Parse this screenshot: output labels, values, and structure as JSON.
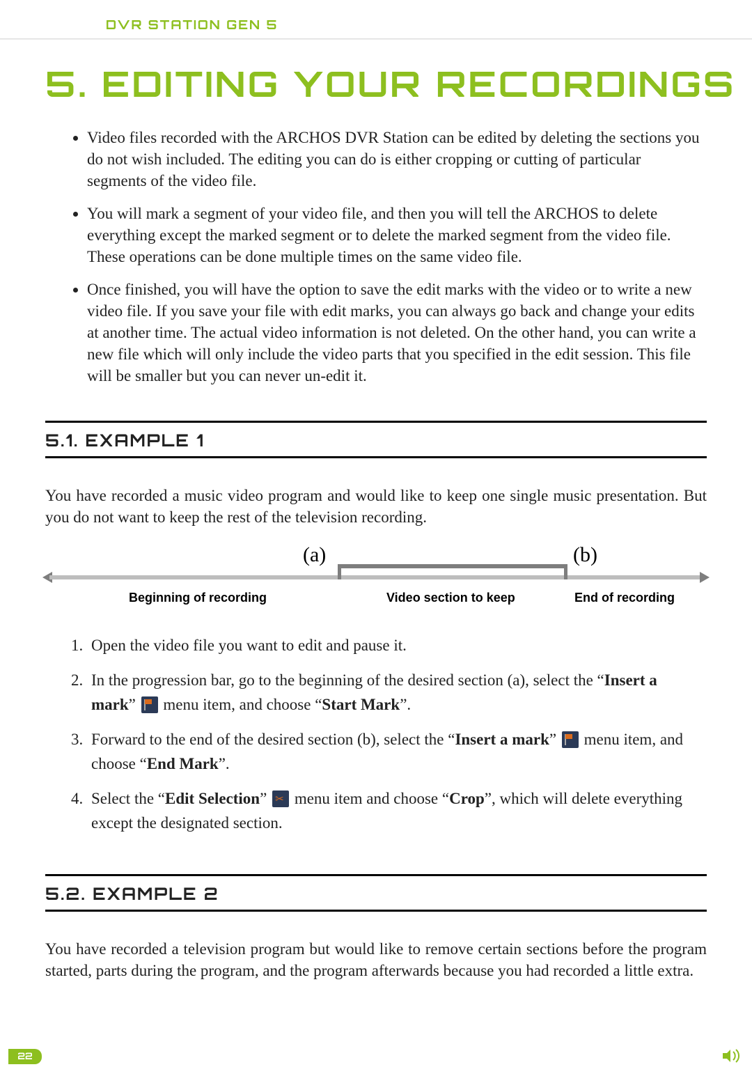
{
  "header": {
    "product": "DVR STATION GEN 5"
  },
  "chapter": {
    "title": "5. EDITING YOUR RECORDINGS"
  },
  "intro_bullets": [
    "Video files recorded with the ARCHOS DVR Station can be edited by deleting the sections you do not wish included. The editing you can do is either cropping or cutting of particular segments of the video file.",
    "You will mark a segment of your video file, and then you will tell the ARCHOS to delete everything except the marked segment or to delete the marked segment from the video file. These operations can be done multiple times on the same video file.",
    "Once finished, you will have the option to save the edit marks with the video or to write a new video file. If you save your file with edit marks, you can always go back and change your edits at another time. The actual video information is not deleted. On the other hand, you can write a new file which will only include the video parts that you specified in the edit session. This file will be smaller but you can never un-edit it."
  ],
  "section1": {
    "heading": "5.1. EXAMPLE 1",
    "para": "You have recorded a music video program and would like to keep one single music presentation. But you do not want to keep the rest of the television recording.",
    "timeline": {
      "a": "(a)",
      "b": "(b)",
      "cap1": "Beginning of recording",
      "cap2": "Video section to keep",
      "cap3": "End of recording"
    },
    "steps": {
      "s1": "Open the video file you want to edit and pause it.",
      "s2a": "In the progression bar, go to the beginning of the desired section (a), select the “",
      "s2b": "Insert a mark",
      "s2c": "” ",
      "s2d": " menu item, and choose “",
      "s2e": "Start Mark",
      "s2f": "”.",
      "s3a": "Forward to the end of the desired section (b), select the “",
      "s3b": "Insert a mark",
      "s3c": "” ",
      "s3d": " menu item, and choose “",
      "s3e": "End Mark",
      "s3f": "”.",
      "s4a": "Select the “",
      "s4b": "Edit Selection",
      "s4c": "” ",
      "s4d": " menu item and choose “",
      "s4e": "Crop",
      "s4f": "”, which will delete everything except the designated section."
    }
  },
  "section2": {
    "heading": "5.2. EXAMPLE 2",
    "para": "You have recorded a television program but would like to remove certain sections before the program started, parts during the program, and the program afterwards because you had recorded a little extra."
  },
  "footer": {
    "page": "22"
  }
}
